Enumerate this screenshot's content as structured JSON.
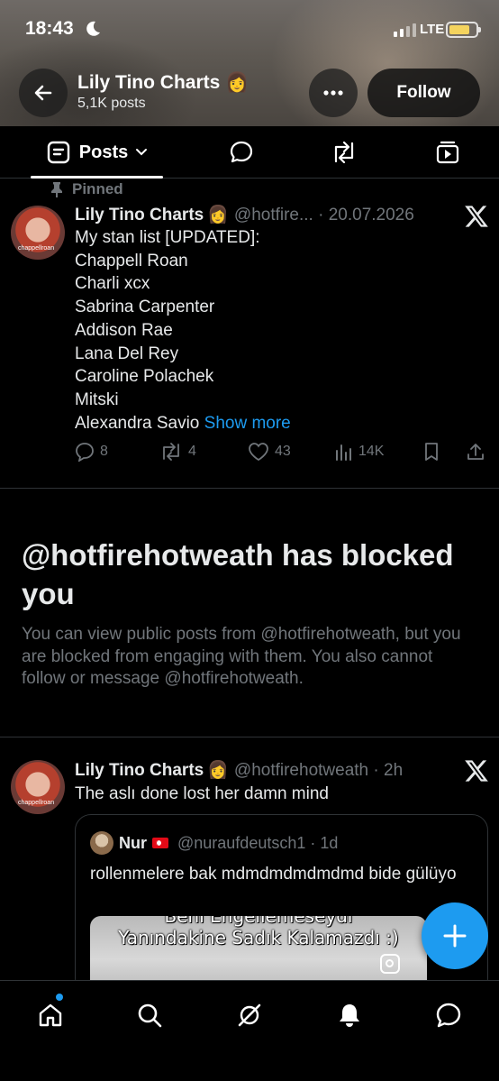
{
  "status_bar": {
    "time": "18:43",
    "network": "LTE",
    "colors": {
      "battery": "#f4d35e"
    }
  },
  "header": {
    "profile_name": "Lily Tino Charts 👩",
    "post_count": "5,1K posts",
    "follow_label": "Follow",
    "icons": [
      "back-arrow-icon",
      "more-icon"
    ]
  },
  "tabs": [
    {
      "label": "Posts",
      "icon": "posts-icon",
      "selected": true
    },
    {
      "label": "",
      "icon": "replies-icon"
    },
    {
      "label": "",
      "icon": "reposts-icon"
    },
    {
      "label": "",
      "icon": "media-icon"
    }
  ],
  "pinned_tweet": {
    "pinned_label": "Pinned",
    "author": "Lily Tino Charts",
    "emoji": "👩",
    "handle_date": "@hotfire... · 20.07.2026",
    "avatar_caption": "chappellroan",
    "lines": [
      "My stan list [UPDATED]:",
      "Chappell Roan",
      "Charli xcx",
      "Sabrina Carpenter",
      "Addison Rae",
      "Lana Del Rey",
      "Caroline Polachek",
      "Mitski",
      "Alexandra Savio"
    ],
    "show_more": "Show more",
    "stats": {
      "replies": "8",
      "reposts": "4",
      "likes": "43",
      "views": "14K"
    }
  },
  "blocked_notice": {
    "title": "@hotfirehotweath has blocked you",
    "description": "You can view public posts from @hotfirehotweath, but you are blocked from engaging with them. You also cannot follow or message @hotfirehotweath."
  },
  "second_tweet": {
    "author": "Lily Tino Charts",
    "emoji": "👩",
    "handle_time": "@hotfirehotweath · 2h",
    "avatar_caption": "chappellroan",
    "text": "The aslı done lost her damn mind",
    "quote": {
      "author": "Nur",
      "handle_time": "@nuraufdeutsch1 · 1d",
      "text": "rollenmelere bak mdmdmdmdmdmd bide gülüyo",
      "media_caption_1": "Beni Engellemeseydi",
      "media_caption_2": "Yanındakine Sadık Kalamazdı :)"
    }
  },
  "bottom_nav": [
    "home-icon",
    "search-icon",
    "grok-icon",
    "notifications-icon",
    "messages-icon"
  ],
  "colors": {
    "accent": "#1d9bf0",
    "background": "#000000",
    "muted": "#71767b",
    "border": "#2f3336"
  }
}
